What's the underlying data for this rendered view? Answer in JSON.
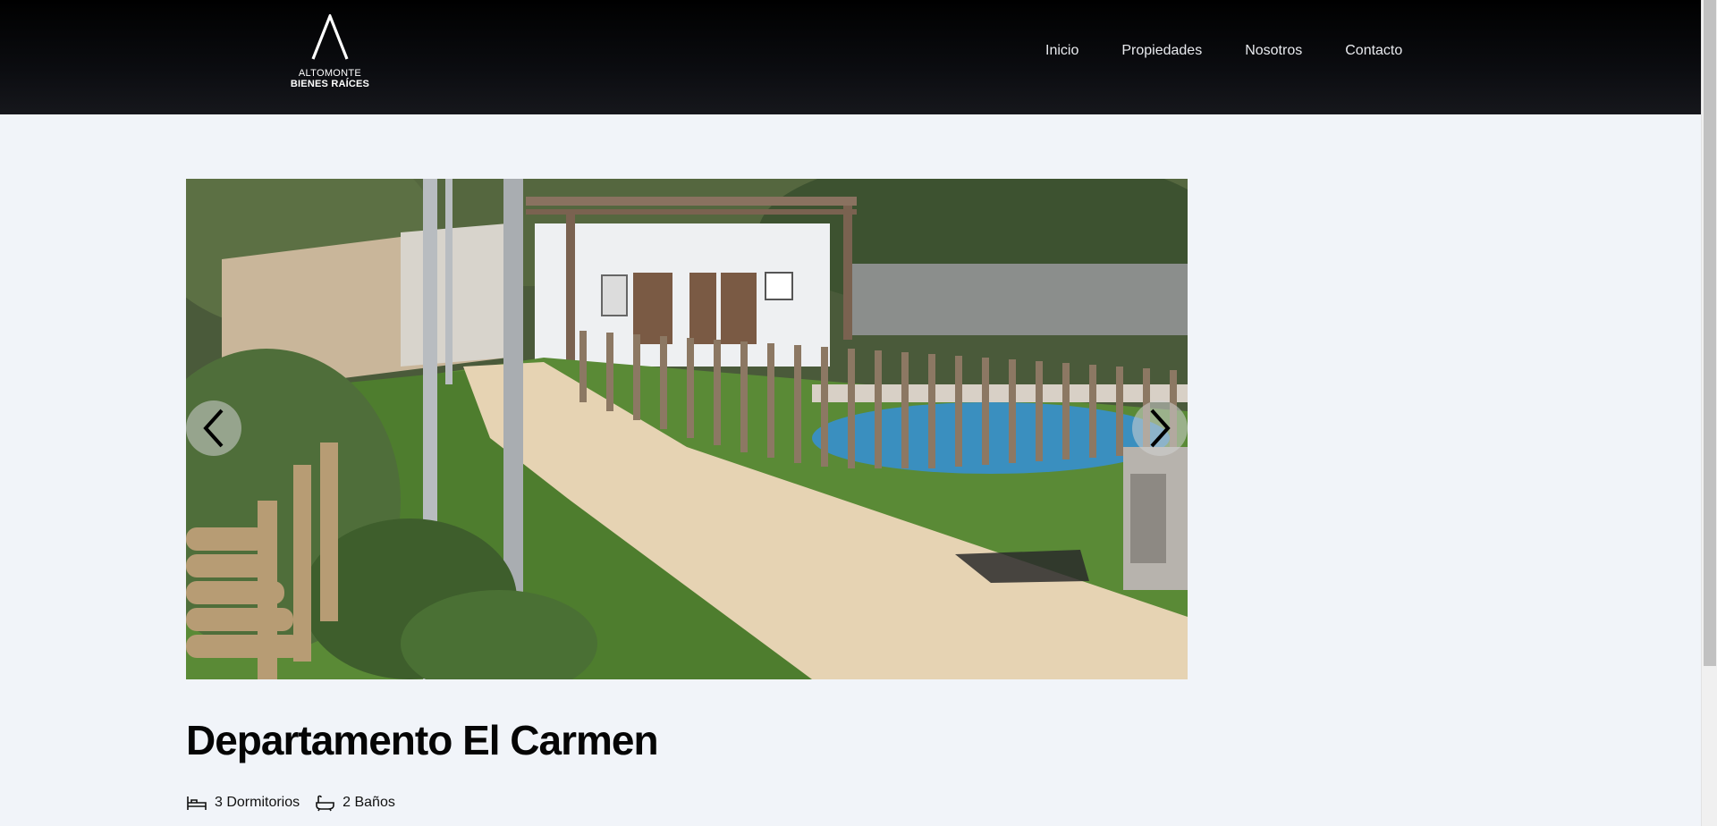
{
  "brand": {
    "name_line1": "ALTOMONTE",
    "name_line2": "BIENES RAÍCES"
  },
  "nav": {
    "items": [
      {
        "label": "Inicio"
      },
      {
        "label": "Propiedades"
      },
      {
        "label": "Nosotros"
      },
      {
        "label": "Contacto"
      }
    ]
  },
  "gallery": {
    "prev_icon": "chevron-left-icon",
    "next_icon": "chevron-right-icon"
  },
  "property": {
    "title": "Departamento El Carmen",
    "bedrooms": "3 Dormitorios",
    "bathrooms": "2 Baños"
  },
  "colors": {
    "header_bg": "#000000",
    "page_bg": "#f1f4f9",
    "nav_text": "#e9ebef"
  }
}
